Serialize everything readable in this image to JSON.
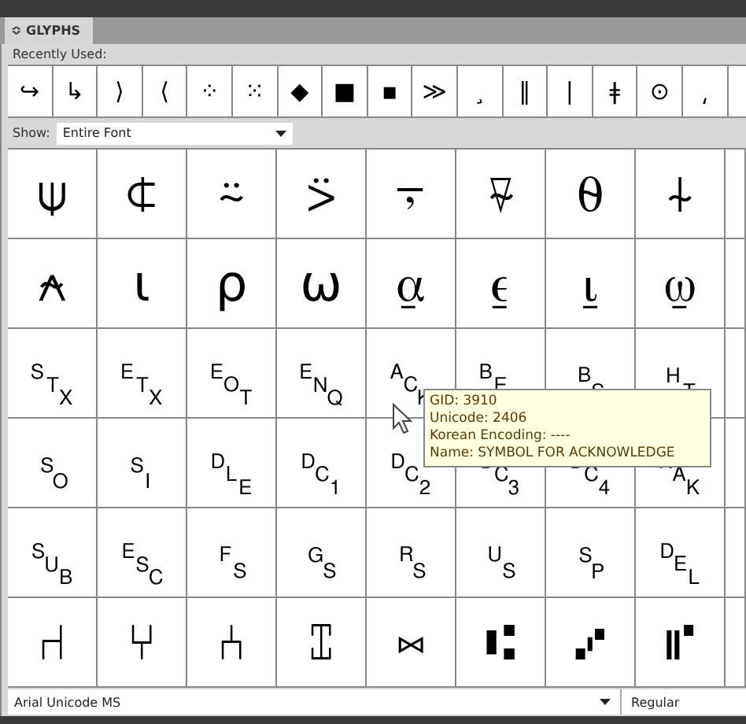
{
  "panel": {
    "tab": {
      "label": "GLYPHS",
      "grip": "≎",
      "selected": true
    }
  },
  "recently_used": {
    "label": "Recently Used:",
    "glyphs": [
      "↪",
      "↳",
      "⟩",
      "⟨",
      "⁘",
      "⁙",
      "◆",
      "■",
      "▪",
      "≫",
      "¸",
      "‖",
      "|",
      "ǂ",
      "⊙",
      "⸲"
    ]
  },
  "show": {
    "label": "Show:",
    "value": "Entire Font"
  },
  "glyph_rows": [
    [
      "⍦",
      "⍧",
      "⍨",
      "⍩",
      "⍪",
      "⍫",
      "⍬",
      "⍭"
    ],
    [
      "⍲",
      "⍳",
      "⍴",
      "⍵",
      "⍶",
      "⍷",
      "⍸",
      "⍹"
    ],
    [
      "␂",
      "␃",
      "␄",
      "␅",
      "␆",
      "␇",
      "␈",
      "␉"
    ],
    [
      "␎",
      "␏",
      "␐",
      "␑",
      "␒",
      "␓",
      "␔",
      "␕"
    ],
    [
      "␚",
      "␛",
      "␜",
      "␝",
      "␞",
      "␟",
      "␠",
      "␡"
    ],
    [
      "⑁",
      "⑂",
      "⑃",
      "⑄",
      "⑅",
      "⑆",
      "⑇",
      "⑈"
    ]
  ],
  "tooltip": {
    "lines": [
      "GID: 3910",
      "Unicode: 2406",
      "Korean Encoding: ----",
      "Name: SYMBOL FOR ACKNOWLEDGE"
    ]
  },
  "font_family": {
    "value": "Arial Unicode MS"
  },
  "font_style": {
    "value": "Regular"
  }
}
